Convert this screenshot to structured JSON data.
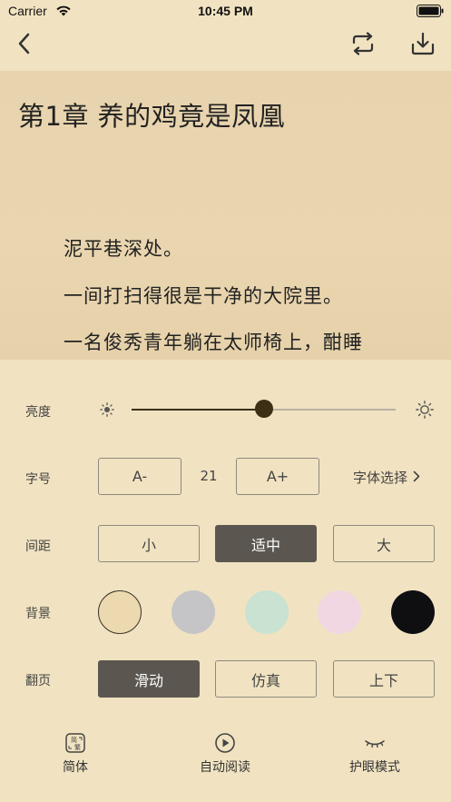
{
  "status_bar": {
    "carrier": "Carrier",
    "time": "10:45 PM"
  },
  "reader": {
    "chapter_title": "第1章 养的鸡竟是凤凰",
    "paragraphs": [
      "泥平巷深处。",
      "一间打扫得很是干净的大院里。",
      "一名俊秀青年躺在太师椅上，酣睡"
    ]
  },
  "settings": {
    "brightness": {
      "label": "亮度",
      "level": 0.5
    },
    "font_size": {
      "label": "字号",
      "decrease": "A-",
      "value": "21",
      "increase": "A+",
      "font_select": "字体选择"
    },
    "spacing": {
      "label": "间距",
      "options": [
        "小",
        "适中",
        "大"
      ],
      "selected": "适中"
    },
    "background": {
      "label": "背景",
      "colors": [
        "#ecd9b0",
        "#c5c5c7",
        "#c9e2d2",
        "#f1d7e2",
        "#0f0e10"
      ],
      "selected": 0
    },
    "page_turn": {
      "label": "翻页",
      "options": [
        "滑动",
        "仿真",
        "上下"
      ],
      "selected": "滑动"
    }
  },
  "tab_bar": {
    "simplified": "简体",
    "auto_read": "自动阅读",
    "eye_care": "护眼模式"
  },
  "colors": {
    "background": "#f1e3c1",
    "accent": "#5b5750",
    "thumb": "#3d2f16"
  }
}
